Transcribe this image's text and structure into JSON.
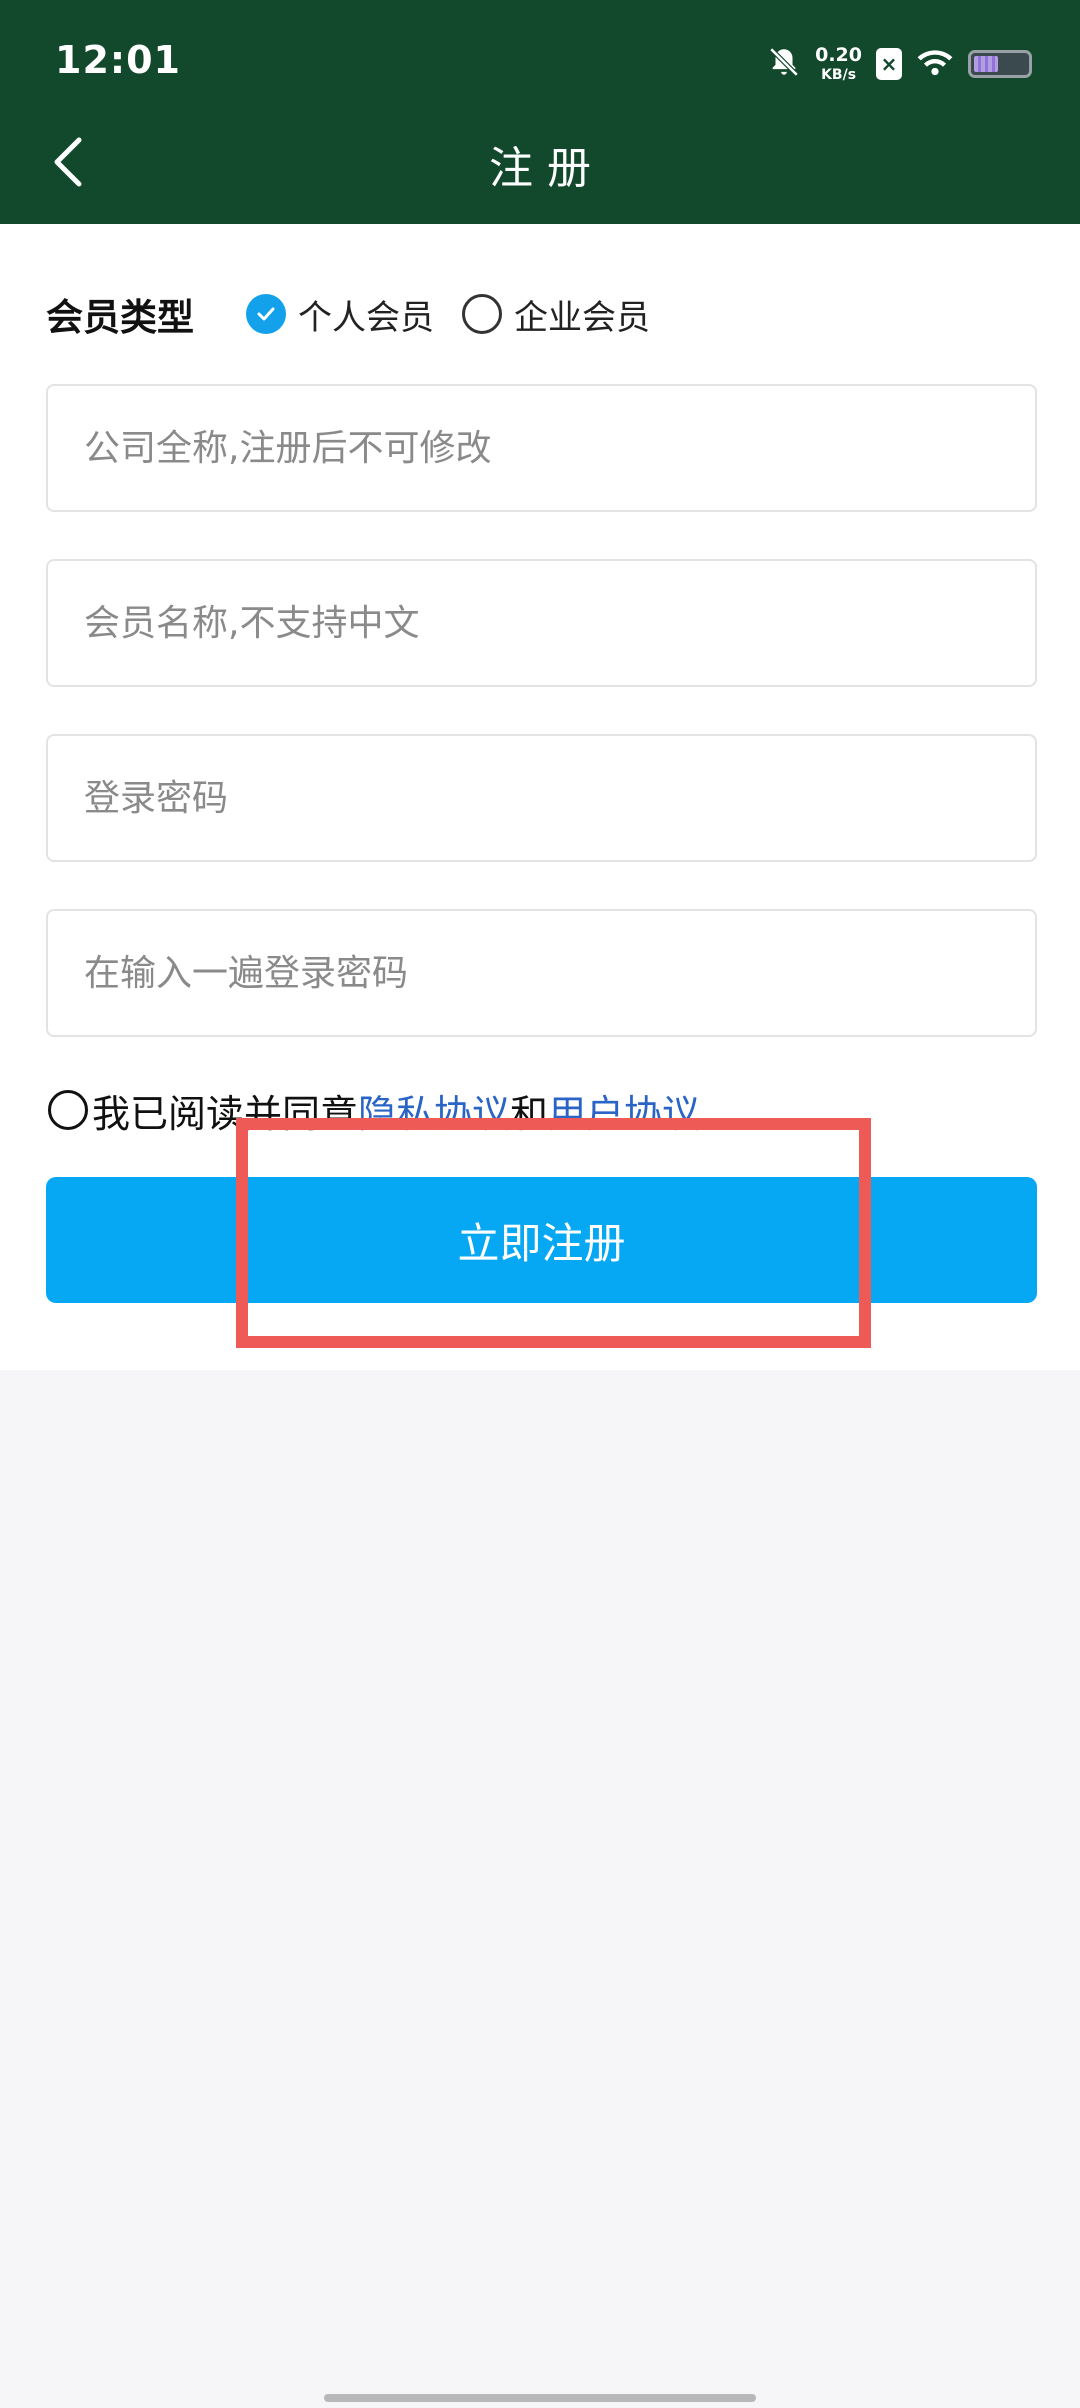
{
  "status_bar": {
    "time": "12:01",
    "net_speed_value": "0.20",
    "net_speed_unit": "KB/s",
    "sim_label": "×",
    "icons": [
      "bell-muted-icon",
      "sim-icon",
      "wifi-icon",
      "battery-icon"
    ]
  },
  "header": {
    "title": "注册",
    "back_icon": "chevron-left-icon"
  },
  "member_type": {
    "label": "会员类型",
    "options": [
      {
        "label": "个人会员",
        "checked": true
      },
      {
        "label": "企业会员",
        "checked": false
      }
    ]
  },
  "form": {
    "company_placeholder": "公司全称,注册后不可修改",
    "member_name_placeholder": "会员名称,不支持中文",
    "password_placeholder": "登录密码",
    "confirm_password_placeholder": "在输入一遍登录密码"
  },
  "agreement": {
    "prefix": "我已阅读并同意",
    "privacy_link": "隐私协议",
    "and": "和",
    "user_link": "用户协议",
    "checked": false
  },
  "submit_label": "立即注册",
  "colors": {
    "header_bg": "#12482b",
    "primary_button": "#06a8f4",
    "radio_checked": "#14a1ec",
    "link": "#2a64c5",
    "highlight": "#ee5a55",
    "page_bg": "#f6f6f8"
  }
}
